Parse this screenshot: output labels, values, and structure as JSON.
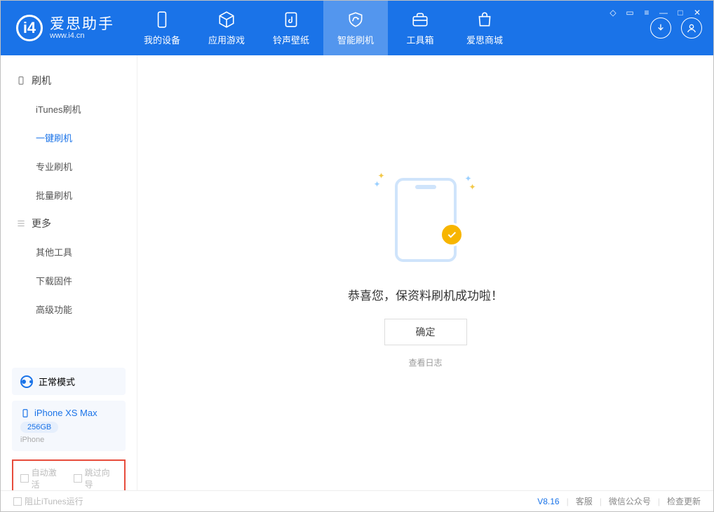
{
  "header": {
    "app_name": "爱思助手",
    "app_url": "www.i4.cn",
    "tabs": [
      "我的设备",
      "应用游戏",
      "铃声壁纸",
      "智能刷机",
      "工具箱",
      "爱思商城"
    ],
    "active_tab_index": 3
  },
  "sidebar": {
    "cat1": "刷机",
    "items1": [
      "iTunes刷机",
      "一键刷机",
      "专业刷机",
      "批量刷机"
    ],
    "active1_index": 1,
    "cat2": "更多",
    "items2": [
      "其他工具",
      "下载固件",
      "高级功能"
    ]
  },
  "mode": {
    "label": "正常模式"
  },
  "device": {
    "name": "iPhone XS Max",
    "capacity": "256GB",
    "type": "iPhone"
  },
  "checks": {
    "auto_activate": "自动激活",
    "skip_guide": "跳过向导"
  },
  "main": {
    "success_text": "恭喜您，保资料刷机成功啦！",
    "ok_btn": "确定",
    "view_log": "查看日志"
  },
  "footer": {
    "stop_itunes": "阻止iTunes运行",
    "version": "V8.16",
    "support": "客服",
    "wechat": "微信公众号",
    "check_update": "检查更新"
  }
}
